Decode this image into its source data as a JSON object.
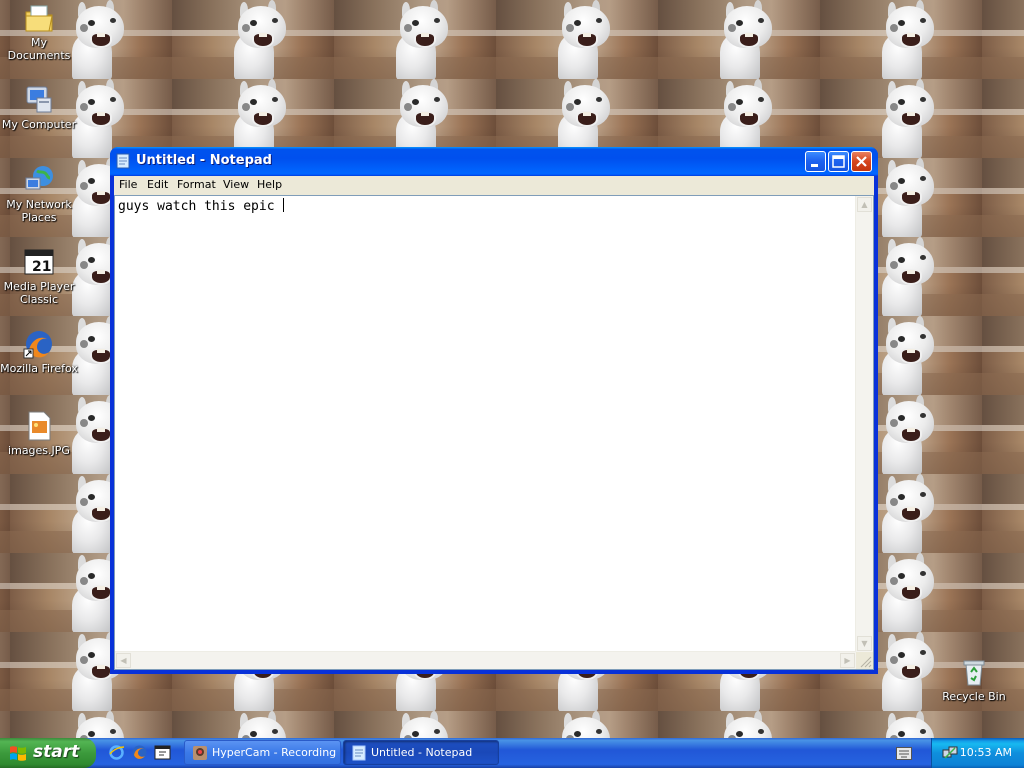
{
  "desktop": {
    "icons": [
      {
        "label": "My Documents",
        "icon": "my-documents-icon"
      },
      {
        "label": "My Computer",
        "icon": "my-computer-icon"
      },
      {
        "label": "My Network Places",
        "icon": "network-places-icon"
      },
      {
        "label": "Media Player Classic",
        "icon": "media-player-classic-icon"
      },
      {
        "label": "Mozilla Firefox",
        "icon": "firefox-icon"
      },
      {
        "label": "images.JPG",
        "icon": "image-file-icon"
      },
      {
        "label": "Recycle Bin",
        "icon": "recycle-bin-icon"
      }
    ]
  },
  "notepad": {
    "title": "Untitled - Notepad",
    "menu": [
      "File",
      "Edit",
      "Format",
      "View",
      "Help"
    ],
    "content": "guys watch this epic "
  },
  "taskbar": {
    "start_label": "start",
    "quick_launch": [
      "ie-icon",
      "firefox-icon",
      "media-player-classic-icon"
    ],
    "tasks": [
      {
        "label": "HyperCam - Recording",
        "active": false
      },
      {
        "label": "Untitled - Notepad",
        "active": true
      }
    ],
    "clock": "10:53 AM"
  },
  "colors": {
    "titlebar": "#0050ee",
    "taskbar": "#2457d6",
    "start_button": "#3c9a3c",
    "tray": "#0f8fdd",
    "close_button": "#d6461d"
  }
}
